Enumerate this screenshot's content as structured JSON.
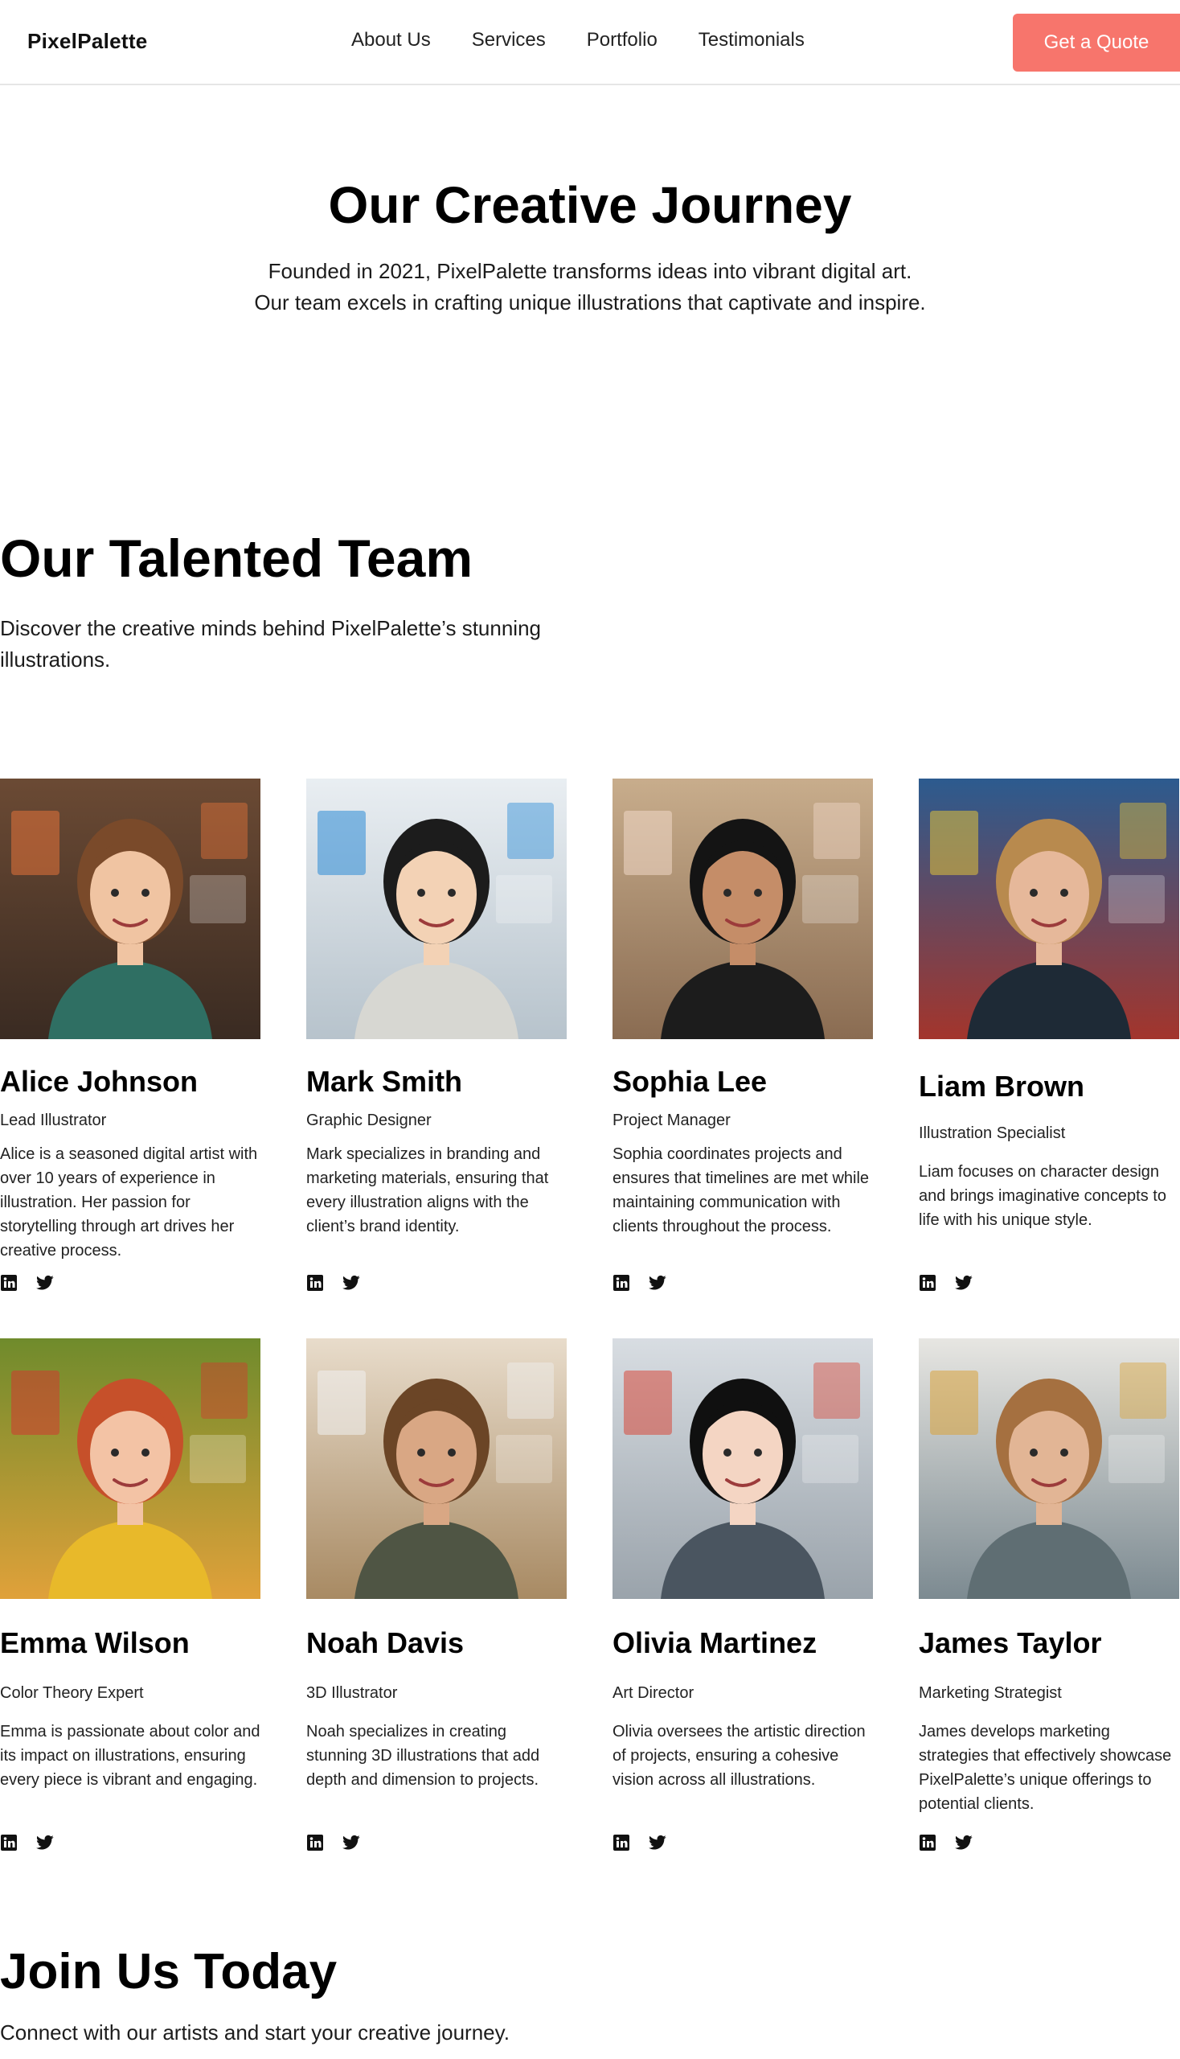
{
  "nav": {
    "logo": "PixelPalette",
    "links": [
      "About Us",
      "Services",
      "Portfolio",
      "Testimonials"
    ],
    "cta": "Get a Quote",
    "cta_color": "#f7756c"
  },
  "hero": {
    "title": "Our Creative Journey",
    "text": "Founded in 2021, PixelPalette transforms ideas into vibrant digital art. Our team excels in crafting unique illustrations that captivate and inspire."
  },
  "team": {
    "title": "Our Talented Team",
    "subtitle": "Discover the creative minds behind PixelPalette’s stunning illustrations.",
    "members": [
      {
        "name": "Alice Johnson",
        "role": "Lead Illustrator",
        "bio": "Alice is a seasoned digital artist with over 10 years of experience in illustration. Her passion for storytelling through art drives her creative process.",
        "photo": "portrait-woman-brown-hair-colorful-scarf"
      },
      {
        "name": "Mark Smith",
        "role": "Graphic Designer",
        "bio": "Mark specializes in branding and marketing materials, ensuring that every illustration aligns with the client’s brand identity.",
        "photo": "illustrated-man-glasses-studio"
      },
      {
        "name": "Sophia Lee",
        "role": "Project Manager",
        "bio": "Sophia coordinates projects and ensures that timelines are met while maintaining communication with clients throughout the process.",
        "photo": "portrait-woman-black-blazer-laptop"
      },
      {
        "name": "Liam Brown",
        "role": "Illustration Specialist",
        "bio": "Liam focuses on character design and brings imaginative concepts to life with his unique style.",
        "photo": "portrait-young-man-art-wall"
      },
      {
        "name": "Emma Wilson",
        "role": "Color Theory Expert",
        "bio": "Emma is passionate about color and its impact on illustrations, ensuring every piece is vibrant and engaging.",
        "photo": "portrait-curly-red-hair-flowers"
      },
      {
        "name": "Noah Davis",
        "role": "3D Illustrator",
        "bio": "Noah specializes in creating stunning 3D illustrations that add depth and dimension to projects.",
        "photo": "portrait-man-green-hoodie-studio"
      },
      {
        "name": "Olivia Martinez",
        "role": "Art Director",
        "bio": "Olivia oversees the artistic direction of projects, ensuring a cohesive vision across all illustrations.",
        "photo": "illustrated-woman-tablet-gallery"
      },
      {
        "name": "James Taylor",
        "role": "Marketing Strategist",
        "bio": "James develops marketing strategies that effectively showcase PixelPalette’s unique offerings to potential clients.",
        "photo": "portrait-man-grey-shirt-gallery"
      }
    ],
    "social_icons": [
      "linkedin-icon",
      "twitter-icon"
    ]
  },
  "join": {
    "title": "Join Us Today",
    "subtitle": "Connect with our artists and start your creative journey."
  }
}
